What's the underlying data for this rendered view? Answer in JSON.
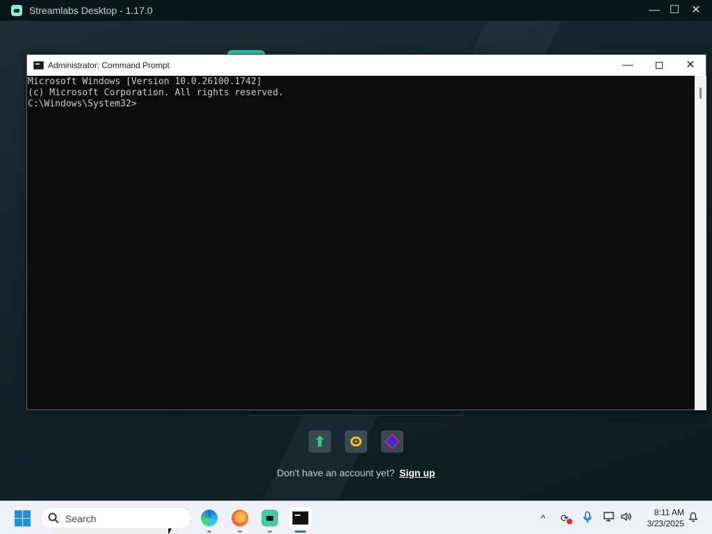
{
  "streamlabs": {
    "title": "Streamlabs Desktop - 1.17.0",
    "controls": {
      "minimize": "—",
      "maximize": "☐",
      "close": "✕"
    },
    "signup_prompt": "Don't have an account yet?",
    "signup_link": "Sign up",
    "platform_icons": [
      "streamlabs-green-icon",
      "kick-yellow-icon",
      "purple-platform-icon"
    ]
  },
  "cmd": {
    "title": "Administrator: Command Prompt",
    "controls": {
      "minimize": "—",
      "close": "✕"
    },
    "lines": [
      "Microsoft Windows [Version 10.0.26100.1742]",
      "(c) Microsoft Corporation. All rights reserved.",
      "",
      "C:\\Windows\\System32>"
    ]
  },
  "taskbar": {
    "search_placeholder": "Search",
    "apps": [
      "Microsoft Edge",
      "Firefox",
      "Streamlabs Desktop",
      "Command Prompt"
    ],
    "tray": {
      "chevron": "^",
      "time": "8:11 AM",
      "date": "3/23/2025"
    }
  },
  "colors": {
    "accent_teal": "#80f5d2",
    "taskbar_active": "#1a73d9",
    "record_red": "#e0261f"
  }
}
